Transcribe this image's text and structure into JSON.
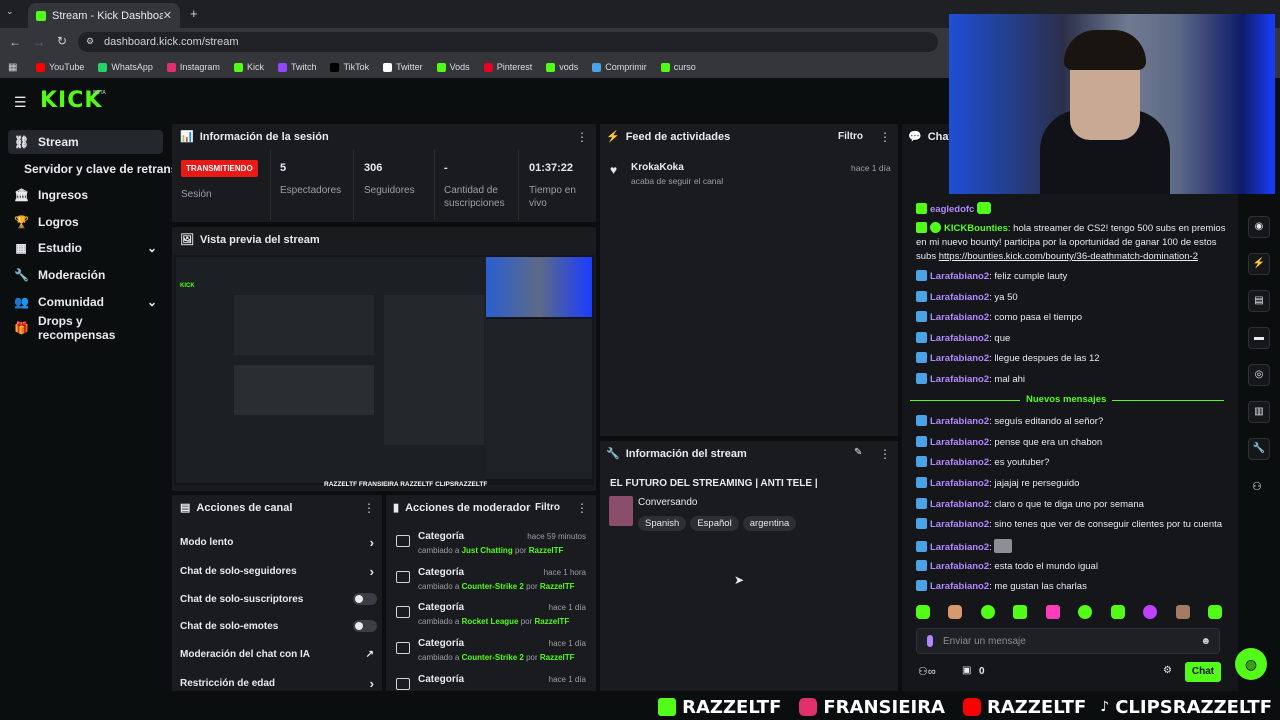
{
  "browser": {
    "tab_title": "Stream - Kick Dashboard",
    "url": "dashboard.kick.com/stream",
    "bookmarks": [
      "YouTube",
      "WhatsApp",
      "Instagram",
      "Kick",
      "Twitch",
      "TikTok",
      "Twitter",
      "Vods",
      "Pinterest",
      "vods",
      "Comprimir",
      "curso"
    ],
    "bookmark_colors": [
      "#ff0000",
      "#25d366",
      "#e1306c",
      "#53fc18",
      "#9146ff",
      "#000000",
      "#ffffff",
      "#53fc18",
      "#e60023",
      "#53fc18",
      "#4aa3e6",
      "#53fc18"
    ]
  },
  "app": {
    "logo": "KICK",
    "logo_badge": "BETA",
    "accent": "#53fc18"
  },
  "sidebar": {
    "items": [
      {
        "label": "Stream",
        "icon": "link-icon"
      },
      {
        "label": "Servidor y clave de retransm"
      },
      {
        "label": "Ingresos",
        "icon": "bank-icon"
      },
      {
        "label": "Logros",
        "icon": "trophy-icon"
      },
      {
        "label": "Estudio",
        "icon": "grid-icon"
      },
      {
        "label": "Moderación",
        "icon": "wrench-icon"
      },
      {
        "label": "Comunidad",
        "icon": "people-icon"
      },
      {
        "label": "Drops y recompensas",
        "icon": "gift-icon"
      }
    ]
  },
  "session": {
    "title": "Información de la sesión",
    "live_badge": "TRANSMITIENDO",
    "live_label": "Sesión",
    "viewers_value": "5",
    "viewers_label": "Espectadores",
    "followers_value": "306",
    "followers_label": "Seguidores",
    "subs_value": "-",
    "subs_label": "Cantidad de suscripciones",
    "time_value": "01:37:22",
    "time_label": "Tiempo en vivo"
  },
  "preview": {
    "title": "Vista previa del stream",
    "overlay_text": "RAZZELTF  FRANSIEIRA  RAZZELTF  CLIPSRAZZELTF"
  },
  "activity": {
    "title": "Feed de actividades",
    "filter": "Filtro",
    "items": [
      {
        "user": "KrokaKoka",
        "action": "acaba de seguir el canal",
        "time": "hace 1 día"
      }
    ]
  },
  "stream_info": {
    "title": "Información del stream",
    "stream_title": "EL FUTURO DEL STREAMING | ANTI TELE |",
    "category": "Conversando",
    "tags": [
      "Spanish",
      "Español",
      "argentina"
    ]
  },
  "channel_actions": {
    "title": "Acciones de canal",
    "items": [
      "Modo lento",
      "Chat de solo-seguidores",
      "Chat de solo-suscriptores",
      "Chat de solo-emotes",
      "Moderación del chat con IA",
      "Restricción de edad"
    ]
  },
  "mod_actions": {
    "title": "Acciones de moderador",
    "filter": "Filtro",
    "items": [
      {
        "title": "Categoría",
        "time": "hace 59 minutos",
        "prefix": "cambiado a",
        "value": "Just Chatting",
        "by": "por",
        "user": "RazzelTF"
      },
      {
        "title": "Categoría",
        "time": "hace 1 hora",
        "prefix": "cambiado a",
        "value": "Counter-Strike 2",
        "by": "por",
        "user": "RazzelTF"
      },
      {
        "title": "Categoría",
        "time": "hace 1 día",
        "prefix": "cambiado a",
        "value": "Rocket League",
        "by": "por",
        "user": "RazzelTF"
      },
      {
        "title": "Categoría",
        "time": "hace 1 día",
        "prefix": "cambiado a",
        "value": "Counter-Strike 2",
        "by": "por",
        "user": "RazzelTF"
      },
      {
        "title": "Categoría",
        "time": "hace 1 día"
      }
    ]
  },
  "chat": {
    "title": "Chat",
    "messages": [
      {
        "user": "eagledofc",
        "text": ""
      },
      {
        "user": "KICKBounties",
        "text": "hola streamer de CS2! tengo 500 subs en premios en mi nuevo bounty! participa por la oportunidad de ganar 100 de estos subs",
        "link": "https://bounties.kick.com/bounty/36-deathmatch-domination-2"
      },
      {
        "user": "Larafabiano2",
        "text": "feliz cumple lauty"
      },
      {
        "user": "Larafabiano2",
        "text": "ya 50"
      },
      {
        "user": "Larafabiano2",
        "text": "como pasa el tiempo"
      },
      {
        "user": "Larafabiano2",
        "text": "que"
      },
      {
        "user": "Larafabiano2",
        "text": "llegue despues de las 12"
      },
      {
        "user": "Larafabiano2",
        "text": "mal ahi"
      },
      {
        "user": "Larafabiano2",
        "text": "seguís editando al señor?"
      },
      {
        "user": "Larafabiano2",
        "text": "pense que era un chabon"
      },
      {
        "user": "Larafabiano2",
        "text": "es youtuber?"
      },
      {
        "user": "Larafabiano2",
        "text": "jajajaj re perseguido"
      },
      {
        "user": "Larafabiano2",
        "text": "claro o que te diga uno por semana"
      },
      {
        "user": "Larafabiano2",
        "text": "sino tenes que ver de conseguir clientes por tu cuenta"
      },
      {
        "user": "Larafabiano2",
        "text": ""
      },
      {
        "user": "Larafabiano2",
        "text": "esta todo el mundo igual"
      },
      {
        "user": "Larafabiano2",
        "text": "me gustan las charlas"
      }
    ],
    "new_messages": "Nuevos mensajes",
    "input_placeholder": "Enviar un mensaje",
    "points": "0",
    "send_label": "Chat"
  },
  "stream_overlay": [
    "RAZZELTF",
    "FRANSIEIRA",
    "RAZZELTF",
    "CLIPSRAZZELTF"
  ]
}
